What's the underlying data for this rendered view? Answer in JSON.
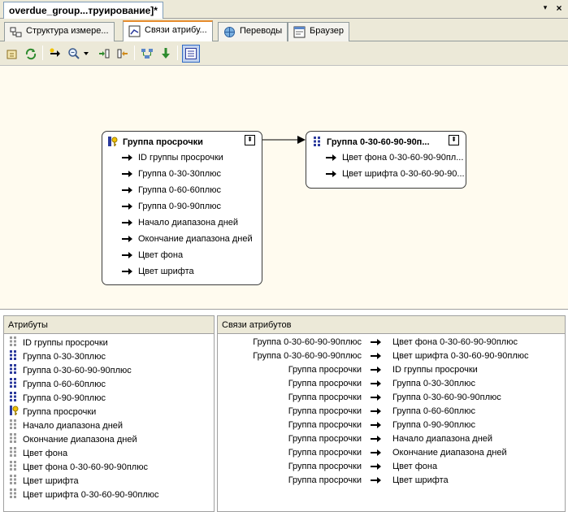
{
  "document": {
    "tab_title": "overdue_group...труирование]*",
    "menu_glyph": "▾",
    "close_glyph": "×"
  },
  "designer_tabs": [
    {
      "label": "Структура измере...",
      "icon": "structure-icon",
      "active": false
    },
    {
      "label": "Связи атрибу...",
      "icon": "relationships-icon",
      "active": true
    },
    {
      "label": "Переводы",
      "icon": "translations-icon",
      "active": false
    },
    {
      "label": "Браузер",
      "icon": "browser-icon",
      "active": false
    }
  ],
  "toolbar": {
    "buttons": [
      "process-icon",
      "refresh-icon",
      "new-relationship-icon",
      "zoom-icon",
      "zoom-dropdown-icon",
      "expand-all-icon",
      "collapse-all-icon",
      "arrange-icon",
      "show-relationship-icon",
      "show-list-views-icon"
    ],
    "checked": "show-list-views-icon"
  },
  "diagram": {
    "source": {
      "title": "Группа просрочки",
      "key_icon": "key-attribute-icon",
      "rows": [
        "ID группы просрочки",
        "Группа 0-30-30плюс",
        "Группа 0-60-60плюс",
        "Группа 0-90-90плюс",
        "Начало диапазона дней",
        "Окончание диапазона дней",
        "Цвет фона",
        "Цвет шрифта"
      ]
    },
    "target": {
      "title": "Группа 0-30-60-90-90п...",
      "rows": [
        "Цвет фона 0-30-60-90-90пл...",
        "Цвет шрифта 0-30-60-90-90..."
      ]
    },
    "collapse_glyph": "⇞"
  },
  "attributes_pane": {
    "header": "Атрибуты",
    "items": [
      {
        "label": "ID группы просрочки",
        "icon": "attribute-gray-icon"
      },
      {
        "label": "Группа 0-30-30плюс",
        "icon": "attribute-blue-icon"
      },
      {
        "label": "Группа 0-30-60-90-90плюс",
        "icon": "attribute-blue-icon"
      },
      {
        "label": "Группа 0-60-60плюс",
        "icon": "attribute-blue-icon"
      },
      {
        "label": "Группа 0-90-90плюс",
        "icon": "attribute-blue-icon"
      },
      {
        "label": "Группа просрочки",
        "icon": "key-attribute-icon"
      },
      {
        "label": "Начало диапазона дней",
        "icon": "attribute-gray-icon"
      },
      {
        "label": "Окончание диапазона дней",
        "icon": "attribute-gray-icon"
      },
      {
        "label": "Цвет фона",
        "icon": "attribute-gray-icon"
      },
      {
        "label": "Цвет фона 0-30-60-90-90плюс",
        "icon": "attribute-gray-icon"
      },
      {
        "label": "Цвет шрифта",
        "icon": "attribute-gray-icon"
      },
      {
        "label": "Цвет шрифта 0-30-60-90-90плюс",
        "icon": "attribute-gray-icon"
      }
    ]
  },
  "relationships_pane": {
    "header": "Связи атрибутов",
    "rows": [
      {
        "from": "Группа 0-30-60-90-90плюс",
        "to": "Цвет фона 0-30-60-90-90плюс"
      },
      {
        "from": "Группа 0-30-60-90-90плюс",
        "to": "Цвет шрифта 0-30-60-90-90плюс"
      },
      {
        "from": "Группа просрочки",
        "to": "ID группы просрочки"
      },
      {
        "from": "Группа просрочки",
        "to": "Группа 0-30-30плюс"
      },
      {
        "from": "Группа просрочки",
        "to": "Группа 0-30-60-90-90плюс"
      },
      {
        "from": "Группа просрочки",
        "to": "Группа 0-60-60плюс"
      },
      {
        "from": "Группа просрочки",
        "to": "Группа 0-90-90плюс"
      },
      {
        "from": "Группа просрочки",
        "to": "Начало диапазона дней"
      },
      {
        "from": "Группа просрочки",
        "to": "Окончание диапазона дней"
      },
      {
        "from": "Группа просрочки",
        "to": "Цвет фона"
      },
      {
        "from": "Группа просрочки",
        "to": "Цвет шрифта"
      }
    ]
  },
  "colors": {
    "canvas_bg": "#fffbef",
    "chrome_bg": "#ece9d8",
    "active_tab_accent": "#e68b2c",
    "attribute_blue": "#2b3a9c",
    "key_gold": "#e0a800"
  }
}
